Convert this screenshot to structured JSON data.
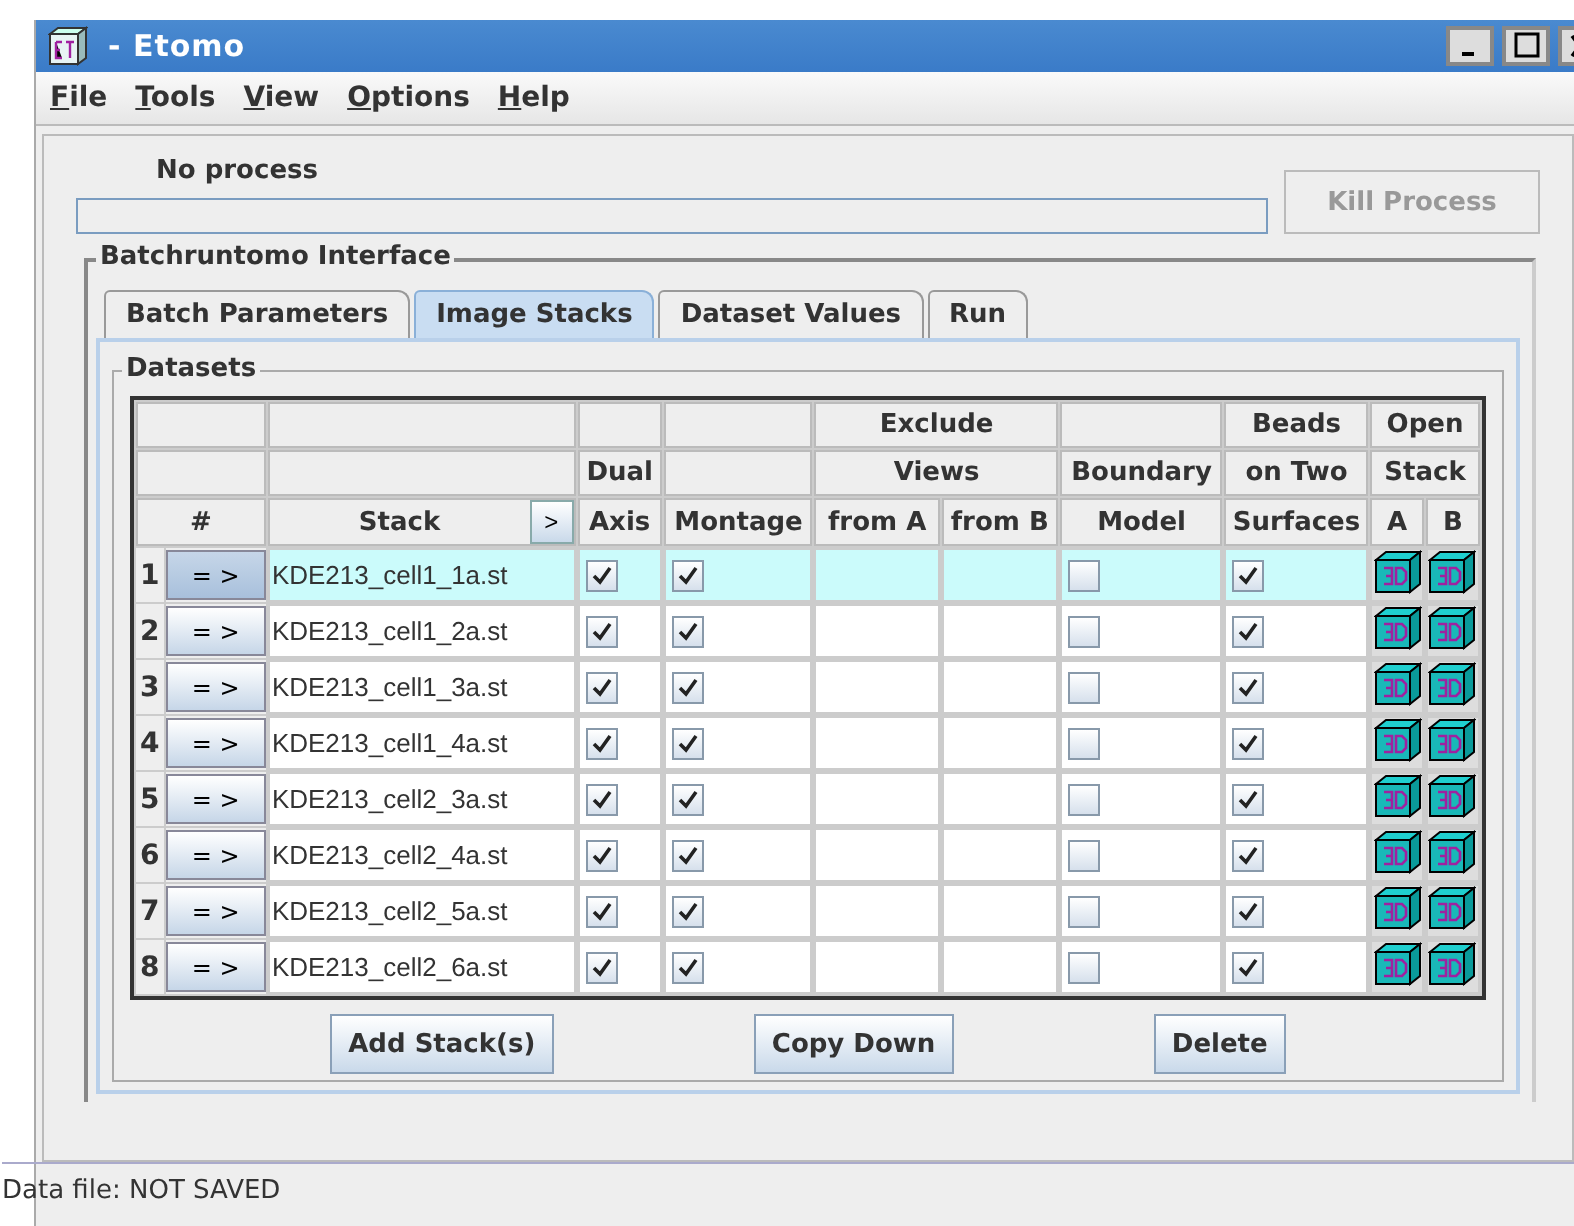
{
  "window": {
    "title": "- Etomo"
  },
  "menu": [
    "File",
    "Tools",
    "View",
    "Options",
    "Help"
  ],
  "process": {
    "label": "No process",
    "kill_button": {
      "label": "Kill Process",
      "disabled": true
    }
  },
  "interface": {
    "title": "Batchruntomo Interface",
    "tabs": [
      {
        "label": "Batch Parameters",
        "selected": false
      },
      {
        "label": "Image Stacks",
        "selected": true
      },
      {
        "label": "Dataset Values",
        "selected": false
      },
      {
        "label": "Run",
        "selected": false
      }
    ],
    "datasets": {
      "title": "Datasets",
      "header_rows": [
        [
          {},
          {},
          {},
          {},
          {
            "text": "Exclude"
          },
          {},
          {
            "text": "Beads"
          },
          {
            "text": "Open"
          }
        ],
        [
          {},
          {},
          {
            "text": "Dual"
          },
          {},
          {
            "text": "Views"
          },
          {
            "text": "Boundary"
          },
          {
            "text": "on Two"
          },
          {
            "text": "Stack"
          }
        ],
        [
          {
            "text": "#"
          },
          {
            "text": "Stack",
            "button": ">"
          },
          {
            "text": "Axis"
          },
          {
            "text": "Montage"
          },
          {
            "text": "from A"
          },
          {
            "text": "from B"
          },
          {
            "text": "Model"
          },
          {
            "text": "Surfaces"
          },
          {
            "text": "A"
          },
          {
            "text": "B"
          }
        ]
      ],
      "rows": [
        {
          "number": "1",
          "go": "= >",
          "stack": "KDE213_cell1_1a.st",
          "dual_axis": true,
          "montage": true,
          "boundary_model": false,
          "beads_on_two_surfaces": true,
          "selected": true
        },
        {
          "number": "2",
          "go": "= >",
          "stack": "KDE213_cell1_2a.st",
          "dual_axis": true,
          "montage": true,
          "boundary_model": false,
          "beads_on_two_surfaces": true,
          "selected": false
        },
        {
          "number": "3",
          "go": "= >",
          "stack": "KDE213_cell1_3a.st",
          "dual_axis": true,
          "montage": true,
          "boundary_model": false,
          "beads_on_two_surfaces": true,
          "selected": false
        },
        {
          "number": "4",
          "go": "= >",
          "stack": "KDE213_cell1_4a.st",
          "dual_axis": true,
          "montage": true,
          "boundary_model": false,
          "beads_on_two_surfaces": true,
          "selected": false
        },
        {
          "number": "5",
          "go": "= >",
          "stack": "KDE213_cell2_3a.st",
          "dual_axis": true,
          "montage": true,
          "boundary_model": false,
          "beads_on_two_surfaces": true,
          "selected": false
        },
        {
          "number": "6",
          "go": "= >",
          "stack": "KDE213_cell2_4a.st",
          "dual_axis": true,
          "montage": true,
          "boundary_model": false,
          "beads_on_two_surfaces": true,
          "selected": false
        },
        {
          "number": "7",
          "go": "= >",
          "stack": "KDE213_cell2_5a.st",
          "dual_axis": true,
          "montage": true,
          "boundary_model": false,
          "beads_on_two_surfaces": true,
          "selected": false
        },
        {
          "number": "8",
          "go": "= >",
          "stack": "KDE213_cell2_6a.st",
          "dual_axis": true,
          "montage": true,
          "boundary_model": false,
          "beads_on_two_surfaces": true,
          "selected": false
        }
      ],
      "buttons": [
        "Add Stack(s)",
        "Copy Down",
        "Delete"
      ]
    }
  },
  "status_bar": "Data file: NOT SAVED"
}
